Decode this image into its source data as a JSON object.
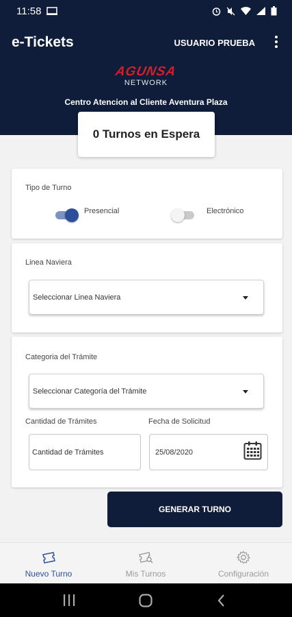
{
  "status_bar": {
    "time": "11:58"
  },
  "app_bar": {
    "title": "e-Tickets",
    "user": "USUARIO PRUEBA"
  },
  "logo": {
    "brand": "AGUNSA",
    "sub": "NETWORK"
  },
  "center_name": "Centro Atencion al Cliente Aventura Plaza",
  "queue": {
    "text": "0 Turnos en Espera"
  },
  "tipo_turno": {
    "label": "Tipo de Turno",
    "options": [
      {
        "label": "Presencial",
        "selected": true
      },
      {
        "label": "Electrónico",
        "selected": false
      }
    ]
  },
  "linea_naviera": {
    "label": "Linea Naviera",
    "value": "Seleccionar Linea Naviera"
  },
  "categoria": {
    "label": "Categoria del Trámite",
    "value": "Seleccionar Categoría del Trámite"
  },
  "cantidad": {
    "label": "Cantidad de Trámites",
    "placeholder": "Cantidad de Trámites"
  },
  "fecha": {
    "label": "Fecha de Solicitud",
    "value": "25/08/2020"
  },
  "button": {
    "label": "GENERAR TURNO"
  },
  "bottom_nav": {
    "items": [
      {
        "label": "Nuevo Turno",
        "active": true,
        "icon": "ticket-icon"
      },
      {
        "label": "Mis Turnos",
        "active": false,
        "icon": "ticket-search-icon"
      },
      {
        "label": "Configuración",
        "active": false,
        "icon": "gear-icon"
      }
    ]
  },
  "colors": {
    "primary": "#0f1c3a",
    "accent": "#2d4f9a",
    "brand_red": "#d0202a",
    "active_nav": "#2d4f9a",
    "inactive_nav": "#9a9a9a"
  },
  "icons": [
    "ticket-icon",
    "ticket-search-icon",
    "gear-icon",
    "calendar-icon",
    "chevron-down-icon",
    "more-vert-icon"
  ]
}
